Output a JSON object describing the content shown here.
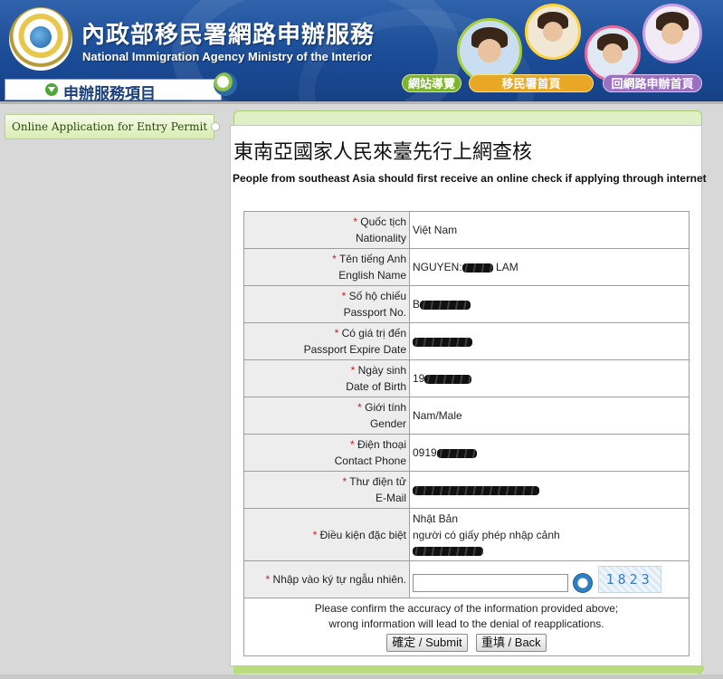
{
  "header": {
    "title_zh": "內政部移民署網路申辦服務",
    "title_en": "National Immigration Agency Ministry of the Interior",
    "nav": {
      "site_guide": "網站導覽",
      "agency_home": "移民署首頁",
      "back_online": "回網路申辦首頁"
    },
    "service_tab": "申辦服務項目"
  },
  "sidebar": {
    "items": [
      {
        "label": "Online Application for Entry Permit"
      }
    ]
  },
  "main": {
    "title": "東南亞國家人民來臺先行上網查核",
    "subtitle": "People from southeast Asia should first receive an online check if applying through internet",
    "rows": [
      {
        "label_vi": "Quốc tịch",
        "label_en": "Nationality",
        "value": "Việt Nam"
      },
      {
        "label_vi": "Tên tiếng Anh",
        "label_en": "English Name",
        "value_prefix": "NGUYEN:",
        "value_suffix": "LAM"
      },
      {
        "label_vi": "Số hộ chiếu",
        "label_en": "Passport No.",
        "value": "B"
      },
      {
        "label_vi": "Có giá trị đến",
        "label_en": "Passport Expire Date",
        "value": ""
      },
      {
        "label_vi": "Ngày sinh",
        "label_en": "Date of Birth",
        "value": "19"
      },
      {
        "label_vi": "Giới tính",
        "label_en": "Gender",
        "value": "Nam/Male"
      },
      {
        "label_vi": "Điện thoại",
        "label_en": "Contact Phone",
        "value": "0919"
      },
      {
        "label_vi": "Thư điện tử",
        "label_en": "E-Mail",
        "value": ""
      },
      {
        "label_vi": "Điều kiện đặc biệt",
        "value_line1": "Nhật Bản",
        "value_line2": "người có giấy phép nhập cảnh"
      },
      {
        "label_vi": "Nhập vào ký tự ngẫu nhiên.",
        "captcha": "1823"
      }
    ],
    "confirm_line1": "Please confirm the accuracy of the information provided above;",
    "confirm_line2": "wrong information will lead to the denial of reapplications.",
    "submit_label": "確定 / Submit",
    "back_label": "重填 / Back",
    "required_mark": "*"
  },
  "colors": {
    "banner_blue": "#1b4c97",
    "required_red": "#d11b1b",
    "panel_green": "#dff0c4"
  }
}
